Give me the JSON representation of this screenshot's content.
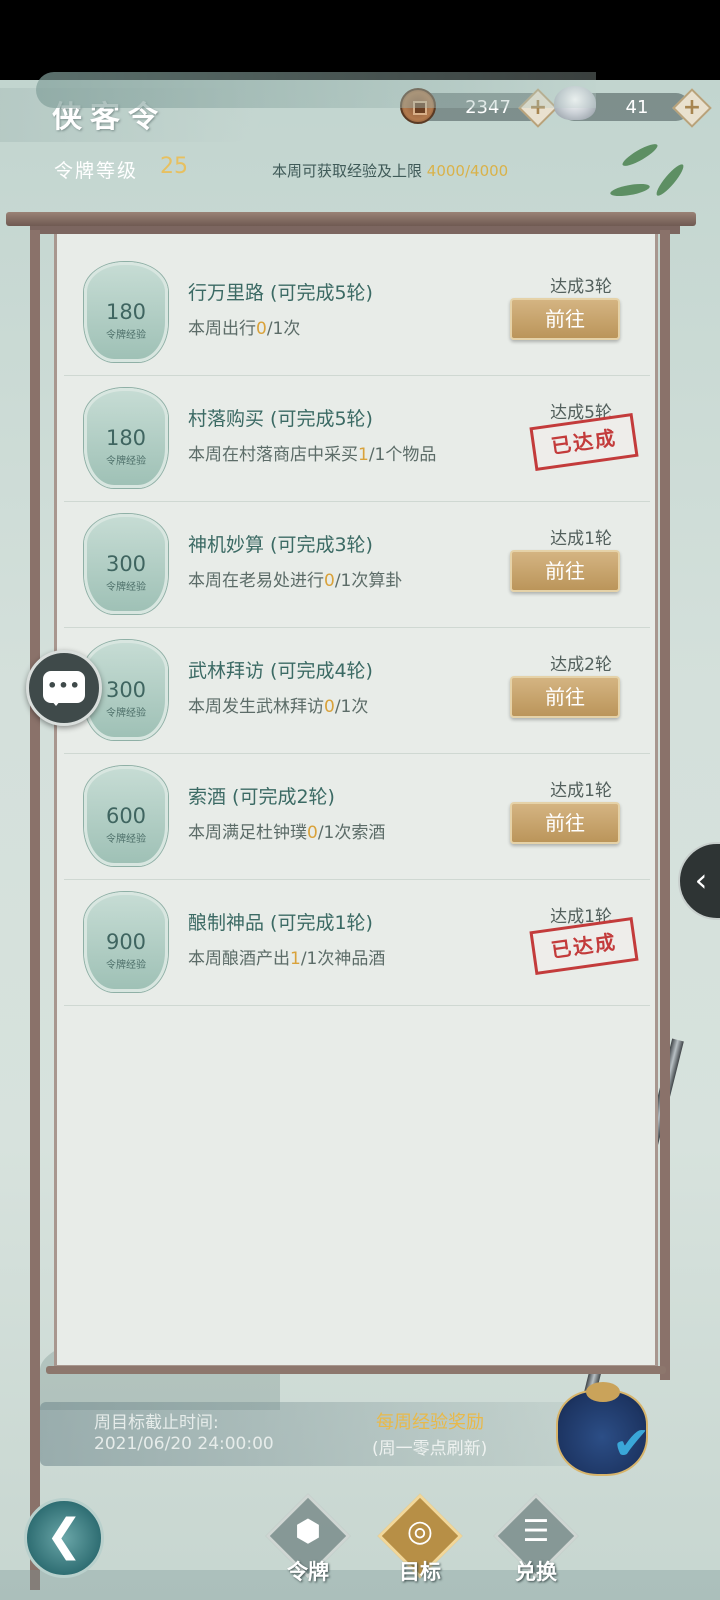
{
  "header": {
    "title": "侠客令",
    "coins": "2347",
    "silver": "41",
    "plus": "+",
    "level_label": "令牌等级",
    "level_value": "25",
    "week_limit_label": "本周可获取经验及上限",
    "week_limit_value": "4000/4000"
  },
  "badge_label": "令牌经验",
  "tasks": [
    {
      "exp": "180",
      "name": "行万里路 (可完成5轮)",
      "desc_pre": "本周出行",
      "desc_num": "0",
      "desc_post": "/1次",
      "rounds": "达成3轮",
      "button": "前往"
    },
    {
      "exp": "180",
      "name": "村落购买 (可完成5轮)",
      "desc_pre": "本周在村落商店中采买",
      "desc_num": "1",
      "desc_post": "/1个物品",
      "rounds": "达成5轮",
      "stamp": "已达成"
    },
    {
      "exp": "300",
      "name": "神机妙算 (可完成3轮)",
      "desc_pre": "本周在老易处进行",
      "desc_num": "0",
      "desc_post": "/1次算卦",
      "rounds": "达成1轮",
      "button": "前往"
    },
    {
      "exp": "300",
      "name": "武林拜访 (可完成4轮)",
      "desc_pre": "本周发生武林拜访",
      "desc_num": "0",
      "desc_post": "/1次",
      "rounds": "达成2轮",
      "button": "前往"
    },
    {
      "exp": "600",
      "name": "索酒 (可完成2轮)",
      "desc_pre": "本周满足杜钟璞",
      "desc_num": "0",
      "desc_post": "/1次索酒",
      "rounds": "达成1轮",
      "button": "前往"
    },
    {
      "exp": "900",
      "name": "酿制神品 (可完成1轮)",
      "desc_pre": "本周酿酒产出",
      "desc_num": "1",
      "desc_post": "/1次神品酒",
      "rounds": "达成1轮",
      "stamp": "已达成"
    }
  ],
  "footer": {
    "deadline_label": "周目标截止时间:",
    "deadline_date": "2021/06/20 24:00:00",
    "reward_title": "每周经验奖励",
    "reward_sub": "(周一零点刷新)"
  },
  "nav": {
    "back": "❮",
    "items": [
      {
        "label": "令牌",
        "glyph": "⬢"
      },
      {
        "label": "目标",
        "glyph": "◎"
      },
      {
        "label": "兑换",
        "glyph": "☰"
      }
    ]
  },
  "icons": {
    "chat": "chat-bubble-icon",
    "side_arrow": "‹",
    "check": "✔"
  },
  "colors": {
    "accent_gold": "#d9b24a",
    "button": "#c6a46c",
    "stamp_red": "#c33b3b",
    "teal_text": "#3b6a64"
  }
}
